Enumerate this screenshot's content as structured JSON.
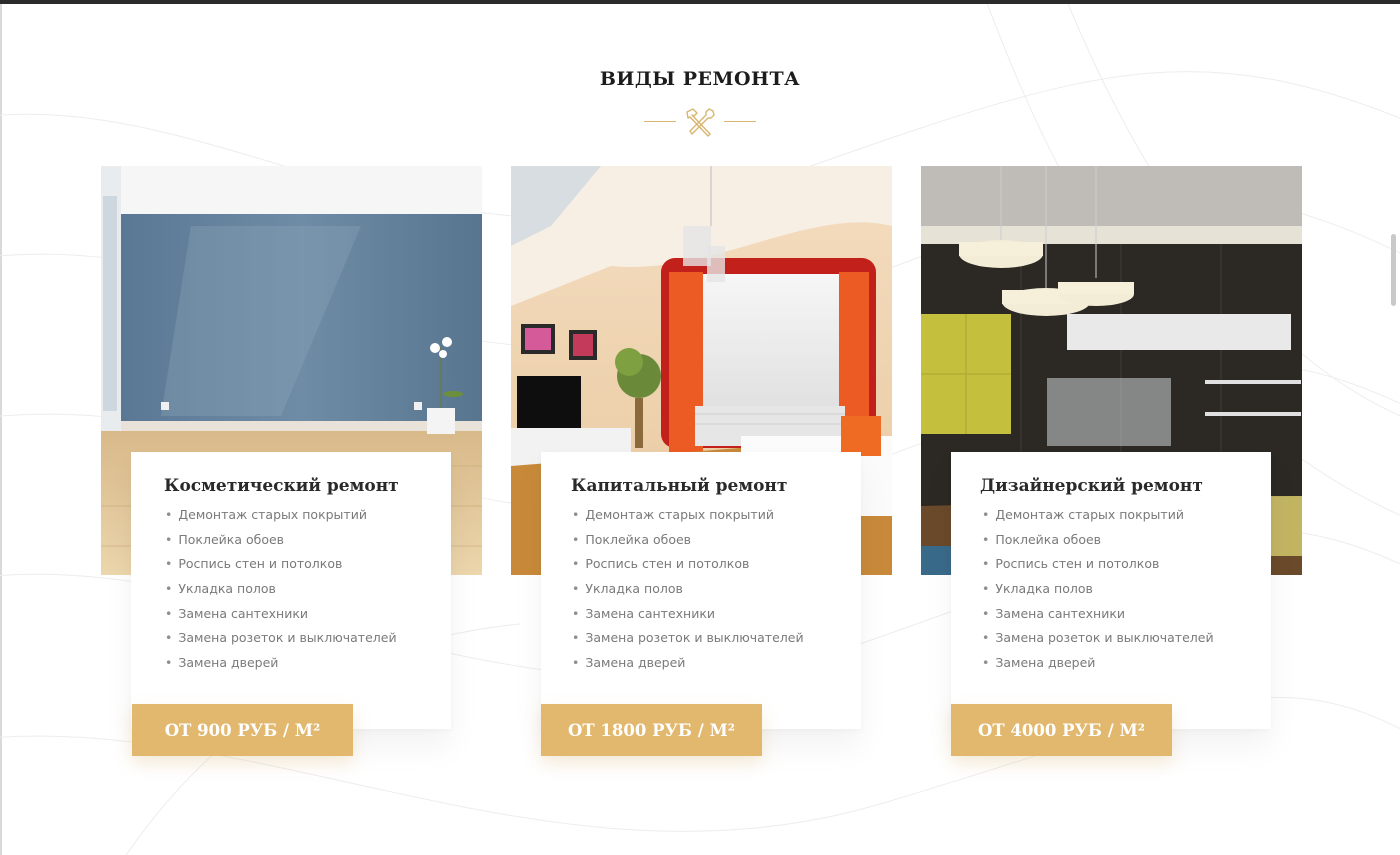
{
  "section": {
    "title": "ВИДЫ РЕМОНТА"
  },
  "icons": {
    "divider": "hammer-wrench-icon"
  },
  "colors": {
    "accent": "#e1b86e",
    "title": "#1c1c1c",
    "muted": "#7a7a7a",
    "top_bar": "#2b2b2b"
  },
  "cards": [
    {
      "title": "Косметический ремонт",
      "photo": "blue-wall-empty-room-photo",
      "features": [
        "Демонтаж старых покрытий",
        "Поклейка обоев",
        "Роспись стен и потолков",
        "Укладка полов",
        "Замена сантехники",
        "Замена розеток и выключателей",
        "Замена дверей"
      ],
      "price_label": "ОТ 900 РУБ / М²"
    },
    {
      "title": "Капитальный ремонт",
      "photo": "living-room-orange-curtains-photo",
      "features": [
        "Демонтаж старых покрытий",
        "Поклейка обоев",
        "Роспись стен и потолков",
        "Укладка полов",
        "Замена сантехники",
        "Замена розеток и выключателей",
        "Замена дверей"
      ],
      "price_label": "ОТ 1800 РУБ / М²"
    },
    {
      "title": "Дизайнерский ремонт",
      "photo": "designer-interior-pendant-lamps-photo",
      "features": [
        "Демонтаж старых покрытий",
        "Поклейка обоев",
        "Роспись стен и потолков",
        "Укладка полов",
        "Замена сантехники",
        "Замена розеток и выключателей",
        "Замена дверей"
      ],
      "price_label": "ОТ 4000 РУБ / М²"
    }
  ]
}
